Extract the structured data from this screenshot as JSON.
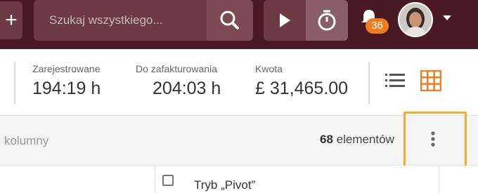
{
  "header": {
    "add_label": "+",
    "search": {
      "placeholder": "Szukaj wszystkiego..."
    },
    "notification_count": "36",
    "icons": {
      "search": "search-icon",
      "play": "play-icon",
      "timer": "stopwatch-icon",
      "bell": "bell-icon",
      "caret": "chevron-down-icon"
    }
  },
  "stats": [
    {
      "label": "Zarejestrowane",
      "value": "194:19 h"
    },
    {
      "label": "Do zafakturowania",
      "value": "204:03 h"
    },
    {
      "label": "Kwota",
      "value": "£ 31,465.00"
    }
  ],
  "view_toggle": {
    "list_icon": "list-view-icon",
    "grid_icon": "grid-view-icon",
    "active": "grid",
    "active_color": "#f07c1e"
  },
  "toolbar": {
    "columns_label": "kolumny",
    "count_number": "68",
    "count_suffix": " elementów",
    "more_icon": "more-vertical-icon"
  },
  "row": {
    "label": "Tryb „Pivot”"
  },
  "colors": {
    "topbar": "#4a1a24",
    "accent": "#f07c1e",
    "highlight": "#f2ad2f"
  }
}
